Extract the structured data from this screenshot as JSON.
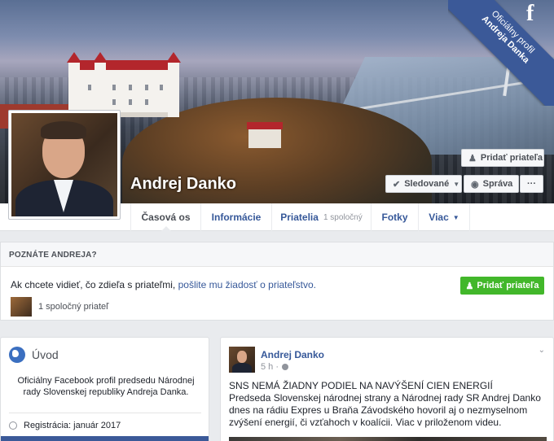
{
  "cover": {
    "ribbon_line1": "Oficiálny profil",
    "ribbon_line2": "Andreja Danka",
    "ribbon_icon": "f"
  },
  "profile": {
    "name": "Andrej Danko",
    "add_friend_label": "Pridať priateľa",
    "following_label": "Sledované",
    "message_label": "Správa",
    "more_label": "···"
  },
  "nav": {
    "items": [
      {
        "label": "Časová os",
        "sub": ""
      },
      {
        "label": "Informácie",
        "sub": ""
      },
      {
        "label": "Priatelia",
        "sub": "1 spoločný"
      },
      {
        "label": "Fotky",
        "sub": ""
      },
      {
        "label": "Viac",
        "sub": ""
      }
    ]
  },
  "know": {
    "heading": "POZNÁTE ANDREJA?",
    "text_prefix": "Ak chcete vidieť, čo zdieľa s priateľmi, ",
    "text_link": "pošlite mu žiadosť o priateľstvo.",
    "button_label": "Pridať priateľa",
    "mutual_label": "1 spoločný priateľ"
  },
  "intro": {
    "title": "Úvod",
    "description": "Oficiálny Facebook profil predsedu Národnej rady Slovenskej republiky Andreja Danka.",
    "registration": "Registrácia: január 2017"
  },
  "post": {
    "author": "Andrej Danko",
    "time": "5 h ·",
    "headline": "SNS NEMÁ ŽIADNY PODIEL NA NAVÝŠENÍ CIEN ENERGIÍ",
    "body": "Predseda Slovenskej národnej strany a Národnej rady SR Andrej Danko dnes na rádiu Expres u Braňa Závodského hovoril aj o nezmyselnom zvýšení energií, či vzťahoch v koalícii. Viac v priloženom videu."
  },
  "colors": {
    "facebook_blue": "#3b5998",
    "link_blue": "#365899",
    "green": "#42b72a",
    "page_bg": "#e9ebee"
  }
}
